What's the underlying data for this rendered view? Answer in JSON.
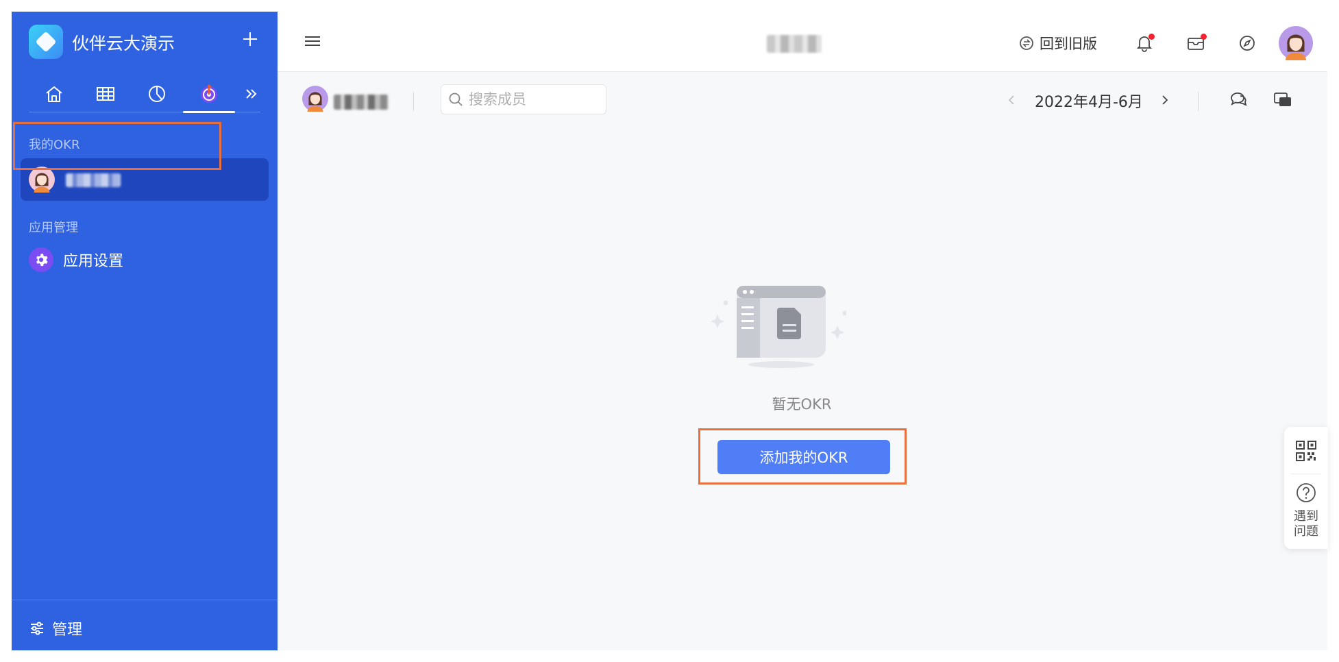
{
  "colors": {
    "sidebar_bg": "#2f62e0",
    "selected_item_bg": "#1f46bd",
    "primary_button": "#4f7ef7",
    "highlight_border": "#e8703e",
    "notification_dot": "#f5222d"
  },
  "sidebar": {
    "app_name": "伙伴云大演示",
    "logo_icon": "app-logo-icon",
    "nav_icons": [
      "home-icon",
      "table-icon",
      "chart-pie-icon",
      "okr-target-icon",
      "double-chevron-right-icon"
    ],
    "active_nav_index": 3,
    "section_my_okr": "我的OKR",
    "section_app_manage": "应用管理",
    "settings_label": "应用设置",
    "manage_label": "管理"
  },
  "topbar": {
    "old_version_label": "回到旧版",
    "icons": [
      "bell-icon",
      "inbox-icon",
      "compass-icon"
    ]
  },
  "subbar": {
    "search_placeholder": "搜索成员",
    "period_label": "2022年4月-6月"
  },
  "empty_state": {
    "message": "暂无OKR",
    "add_button_label": "添加我的OKR"
  },
  "float_panel": {
    "help_label_line1": "遇到",
    "help_label_line2": "问题"
  }
}
